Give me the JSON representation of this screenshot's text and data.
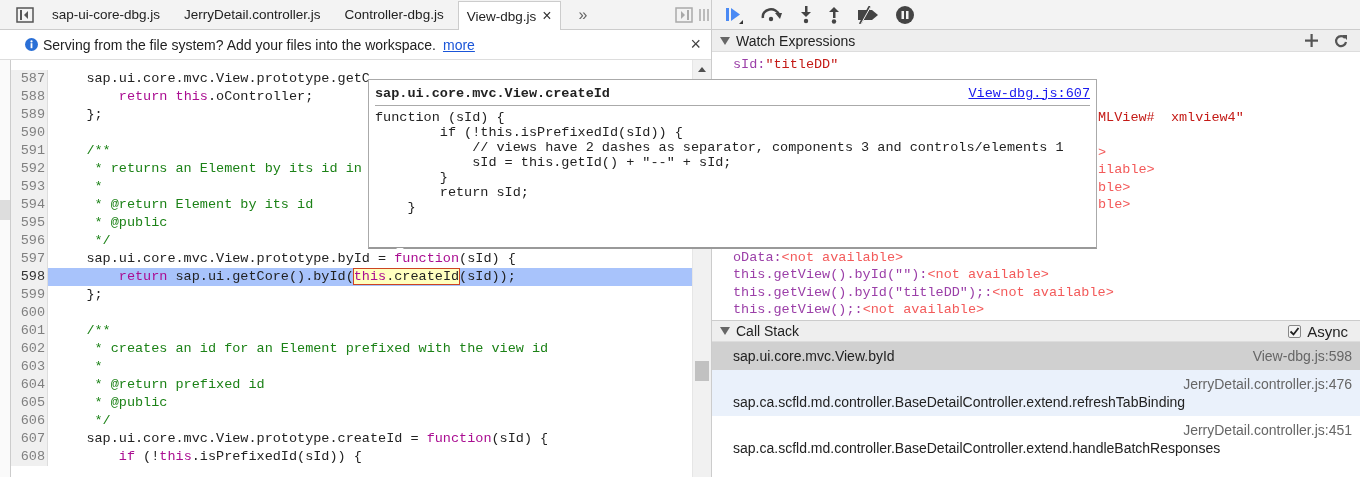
{
  "editor_tabs": {
    "tabs": [
      {
        "label": "sap-ui-core-dbg.js",
        "selected": false
      },
      {
        "label": "JerryDetail.controller.js",
        "selected": false
      },
      {
        "label": "Controller-dbg.js",
        "selected": false
      },
      {
        "label": "View-dbg.js",
        "selected": true,
        "close": "×"
      }
    ],
    "overflow": "»"
  },
  "infobar": {
    "message": "Serving from the file system? Add your files into the workspace.",
    "link": "more",
    "close": "×"
  },
  "code": {
    "lines": [
      {
        "number": "587",
        "current": false,
        "tokens": [
          {
            "kind": "plain",
            "t": "    sap.ui.core.mvc.View.prototype.getC"
          }
        ]
      },
      {
        "number": "588",
        "current": false,
        "tokens": [
          {
            "kind": "keyword",
            "t": "        return "
          },
          {
            "kind": "keyword",
            "t": "this"
          },
          {
            "kind": "plain",
            "t": ".oController;"
          }
        ]
      },
      {
        "number": "589",
        "current": false,
        "tokens": [
          {
            "kind": "plain",
            "t": "    };"
          }
        ]
      },
      {
        "number": "590",
        "current": false
      },
      {
        "number": "591",
        "current": false,
        "tokens": [
          {
            "kind": "comment",
            "t": "    /**"
          }
        ]
      },
      {
        "number": "592",
        "current": false,
        "tokens": [
          {
            "kind": "comment",
            "t": "     * returns an Element by its id in"
          }
        ]
      },
      {
        "number": "593",
        "current": false,
        "tokens": [
          {
            "kind": "comment",
            "t": "     *"
          }
        ]
      },
      {
        "number": "594",
        "current": false,
        "tokens": [
          {
            "kind": "comment",
            "t": "     * @return Element by its id"
          }
        ]
      },
      {
        "number": "595",
        "current": false,
        "tokens": [
          {
            "kind": "comment",
            "t": "     * @public"
          }
        ]
      },
      {
        "number": "596",
        "current": false,
        "tokens": [
          {
            "kind": "comment",
            "t": "     */"
          }
        ]
      },
      {
        "number": "597",
        "current": false,
        "tokens": [
          {
            "kind": "plain",
            "t": "    sap.ui.core.mvc.View.prototype.byId = "
          },
          {
            "kind": "keyword",
            "t": "function"
          },
          {
            "kind": "plain",
            "t": "(sId) {"
          }
        ]
      },
      {
        "number": "598",
        "current": true,
        "tokens": [
          {
            "kind": "keyword",
            "t": "        return"
          },
          {
            "kind": "plain",
            "t": " sap.ui.getCore().byId("
          },
          {
            "kind": "evaluated",
            "parts": [
              {
                "kind": "keyword",
                "t": "this"
              },
              {
                "kind": "plain",
                "t": ".createId"
              }
            ]
          },
          {
            "kind": "plain",
            "t": "(sId));"
          }
        ]
      },
      {
        "number": "599",
        "current": false,
        "tokens": [
          {
            "kind": "plain",
            "t": "    };"
          }
        ]
      },
      {
        "number": "600",
        "current": false
      },
      {
        "number": "601",
        "current": false,
        "tokens": [
          {
            "kind": "comment",
            "t": "    /**"
          }
        ]
      },
      {
        "number": "602",
        "current": false,
        "tokens": [
          {
            "kind": "comment",
            "t": "     * creates an id for an Element prefixed with the view id"
          }
        ]
      },
      {
        "number": "603",
        "current": false,
        "tokens": [
          {
            "kind": "comment",
            "t": "     *"
          }
        ]
      },
      {
        "number": "604",
        "current": false,
        "tokens": [
          {
            "kind": "comment",
            "t": "     * @return prefixed id"
          }
        ]
      },
      {
        "number": "605",
        "current": false,
        "tokens": [
          {
            "kind": "comment",
            "t": "     * @public"
          }
        ]
      },
      {
        "number": "606",
        "current": false,
        "tokens": [
          {
            "kind": "comment",
            "t": "     */"
          }
        ]
      },
      {
        "number": "607",
        "current": false,
        "tokens": [
          {
            "kind": "plain",
            "t": "    sap.ui.core.mvc.View.prototype.createId = "
          },
          {
            "kind": "keyword",
            "t": "function"
          },
          {
            "kind": "plain",
            "t": "(sId) {"
          }
        ]
      },
      {
        "number": "608",
        "current": false,
        "tokens": [
          {
            "kind": "keyword",
            "t": "        if"
          },
          {
            "kind": "plain",
            "t": " (!"
          },
          {
            "kind": "keyword",
            "t": "this"
          },
          {
            "kind": "plain",
            "t": ".isPrefixedId(sId)) {"
          }
        ]
      }
    ]
  },
  "popover": {
    "title": "sap.ui.core.mvc.View.createId",
    "location": "View-dbg.js:607",
    "lines": [
      "function (sId) {",
      "        if (!this.isPrefixedId(sId)) {",
      "            // views have 2 dashes as separator, components 3 and controls/elements 1",
      "            sId = this.getId() + \"--\" + sId;",
      "        }",
      "        return sId;",
      "    }"
    ]
  },
  "watch": {
    "title": "Watch Expressions",
    "rows": [
      {
        "kind": "full",
        "name": "sId:",
        "value": "\"titleDD\"",
        "available": true
      },
      {
        "kind": "tail",
        "value": "MLView#  xmlview4\"",
        "available": true
      },
      {
        "kind": "tail",
        "value": ">",
        "available": false
      },
      {
        "kind": "tail",
        "value": "ilable>",
        "available": false
      },
      {
        "kind": "tail",
        "value": "ble>",
        "available": false
      },
      {
        "kind": "tail",
        "value": "ble>",
        "available": false
      },
      {
        "kind": "full",
        "name": "oData:",
        "value": "<not available>",
        "available": false
      },
      {
        "kind": "full",
        "name": "this.getView().byId(\"\"):",
        "value": "<not available>",
        "available": false
      },
      {
        "kind": "full",
        "name": "this.getView().byId(\"titleDD\");:",
        "value": "<not available>",
        "available": false
      },
      {
        "kind": "full",
        "name": "this.getView();:",
        "value": "<not available>",
        "available": false
      }
    ]
  },
  "call_stack": {
    "title": "Call Stack",
    "async": {
      "label": "Async",
      "checked": true
    },
    "frames": [
      {
        "name": "sap.ui.core.mvc.View.byId",
        "location": "View-dbg.js:598",
        "selected": true
      },
      {
        "name": "sap.ca.scfld.md.controller.BaseDetailController.extend.refreshTabBinding",
        "location": "JerryDetail.controller.js:476",
        "selected": false
      },
      {
        "name": "sap.ca.scfld.md.controller.BaseDetailController.extend.handleBatchResponses",
        "location": "JerryDetail.controller.js:451",
        "selected": false
      }
    ]
  }
}
